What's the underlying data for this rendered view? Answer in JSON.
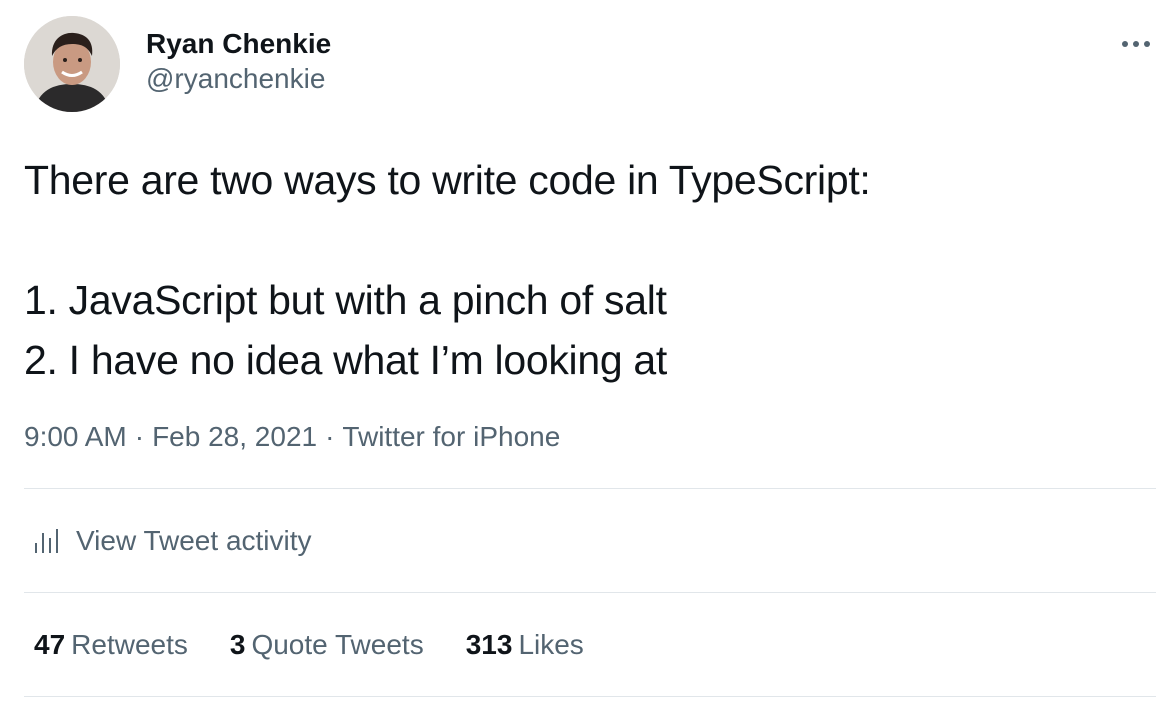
{
  "author": {
    "display_name": "Ryan Chenkie",
    "handle": "@ryanchenkie"
  },
  "tweet": {
    "lines": [
      "There are two ways to write code in TypeScript:",
      "",
      "1. JavaScript but with a pinch of salt",
      "2. I have no idea what I’m looking at"
    ]
  },
  "meta": {
    "time": "9:00 AM",
    "separator": "·",
    "date": "Feb 28, 2021",
    "source": "Twitter for iPhone"
  },
  "activity": {
    "label": "View Tweet activity",
    "icon": "bar-chart-icon"
  },
  "stats": {
    "retweets_count": "47",
    "retweets_label": "Retweets",
    "quotes_count": "3",
    "quotes_label": "Quote Tweets",
    "likes_count": "313",
    "likes_label": "Likes"
  },
  "more_icon": "more-horizontal-icon",
  "colors": {
    "text_primary": "#0f1419",
    "text_secondary": "#536471",
    "divider": "#e1e6ea"
  }
}
